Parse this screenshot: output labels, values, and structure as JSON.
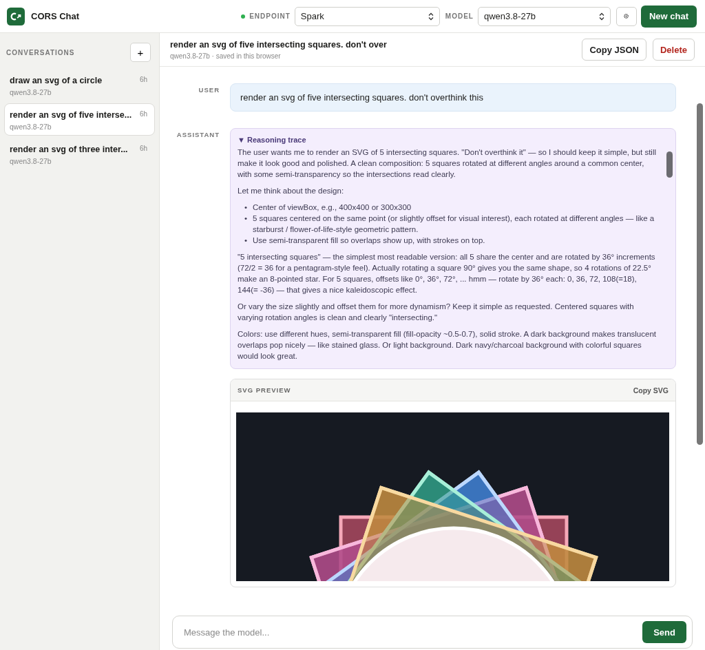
{
  "header": {
    "app_name": "CORS Chat",
    "endpoint_label": "ENDPOINT",
    "endpoint": "Spark",
    "model_label": "MODEL",
    "model": "qwen3.8-27b",
    "new_chat": "New chat"
  },
  "sidebar": {
    "title": "CONVERSATIONS",
    "add": "+",
    "items": [
      {
        "title": "draw an svg of a circle",
        "model": "qwen3.8-27b",
        "time": "6h",
        "selected": false
      },
      {
        "title": "render an svg of five interse...",
        "model": "qwen3.8-27b",
        "time": "6h",
        "selected": true
      },
      {
        "title": "render an svg of three inter...",
        "model": "qwen3.8-27b",
        "time": "6h",
        "selected": false
      }
    ]
  },
  "conversation": {
    "title": "render an svg of five intersecting squares. don't over",
    "meta": "qwen3.8-27b · saved in this browser",
    "buttons": [
      {
        "label": "Copy JSON",
        "kind": "plain"
      },
      {
        "label": "Delete",
        "kind": "danger"
      }
    ]
  },
  "messages": [
    {
      "role": "USER",
      "kind": "user",
      "text": "render an svg of five intersecting squares. don't overthink this"
    },
    {
      "role": "ASSISTANT",
      "kind": "assistant",
      "reasoning": {
        "toggle": "▼",
        "title": "Reasoning trace",
        "expanded": true,
        "blocks": [
          {
            "kind": "p",
            "text": "The user wants me to render an SVG of 5 intersecting squares. \"Don't overthink it\" — so I should keep it simple, but still make it look good and polished. A clean composition: 5 squares rotated at different angles around a common center, with some semi-transparency so the intersections read clearly."
          },
          {
            "kind": "p",
            "text": "Let me think about the design:"
          },
          {
            "kind": "list",
            "marker": "•",
            "items": [
              "Center of viewBox, e.g., 400x400 or 300x300",
              "5 squares centered on the same point (or slightly offset for visual interest), each rotated at different angles — like a starburst / flower-of-life-style geometric pattern.",
              "Use semi-transparent fill so overlaps show up, with strokes on top."
            ]
          },
          {
            "kind": "p",
            "text": "\"5 intersecting squares\" — the simplest most readable version: all 5 share the center and are rotated by 36° increments (72/2 = 36 for a pentagram-style feel). Actually rotating a square 90° gives you the same shape, so 4 rotations of 22.5° make an 8-pointed star. For 5 squares, offsets like 0°, 36°, 72°, ... hmm — rotate by 36° each: 0, 36, 72, 108(=18), 144(= -36) — that gives a nice kaleidoscopic effect."
          },
          {
            "kind": "p",
            "text": "Or vary the size slightly and offset them for more dynamism? Keep it simple as requested. Centered squares with varying rotation angles is clean and clearly \"intersecting.\""
          },
          {
            "kind": "p",
            "text": "Colors: use different hues, semi-transparent fill (fill-opacity ~0.5-0.7), solid stroke. A dark background makes translucent overlaps pop nicely — like stained glass. Or light background. Dark navy/charcoal background with colorful squares would look great."
          }
        ]
      },
      "preview": {
        "label": "SVG PREVIEW",
        "copy": "Copy SVG"
      }
    }
  ],
  "composer": {
    "placeholder": "Message the model...",
    "send": "Send"
  }
}
